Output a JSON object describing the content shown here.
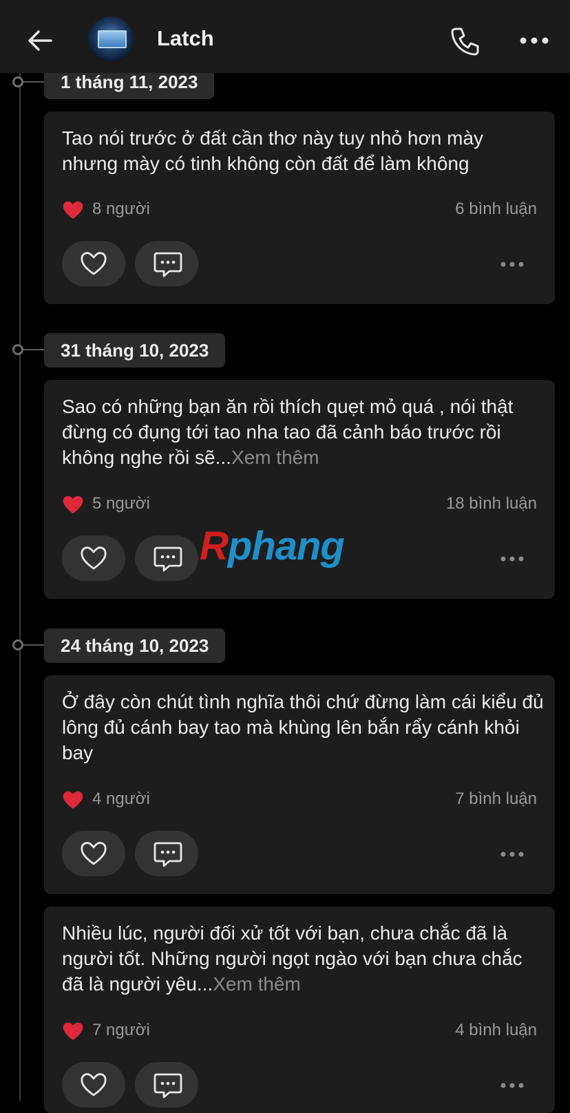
{
  "header": {
    "title": "Latch",
    "icons": [
      "back-arrow-icon",
      "avatar",
      "phone-icon",
      "more-icon"
    ]
  },
  "watermark": {
    "first": "R",
    "rest": "phang"
  },
  "posts": [
    {
      "date": "1 tháng 11, 2023",
      "text": "Tao nói trước ở đất cần thơ này tuy nhỏ hơn mày nhưng mày có tinh không còn đất để làm không",
      "more": "",
      "likes": "8 người",
      "comments": "6 bình luận"
    },
    {
      "date": "31 tháng 10, 2023",
      "text": "Sao có những bạn ăn rồi thích quẹt mỏ quá , nói thật đừng có đụng tới tao nha tao đã cảnh báo trước rồi không nghe rồi sẽ...",
      "more": "Xem thêm",
      "likes": "5 người",
      "comments": "18 bình luận"
    },
    {
      "date": "24 tháng 10, 2023",
      "text": "Ở đây còn chút tình nghĩa thôi chứ đừng làm cái kiểu đủ lông đủ cánh bay tao mà khùng lên bắn rẩy cánh khỏi bay",
      "more": "",
      "likes": "4 người",
      "comments": "7 bình luận"
    },
    {
      "date": "",
      "text": "Nhiều lúc, người đối xử tốt với bạn, chưa chắc đã là người tốt. Những người ngọt ngào với bạn chưa chắc đã là người yêu...",
      "more": "Xem thêm",
      "likes": "7 người",
      "comments": "4 bình luận"
    }
  ]
}
